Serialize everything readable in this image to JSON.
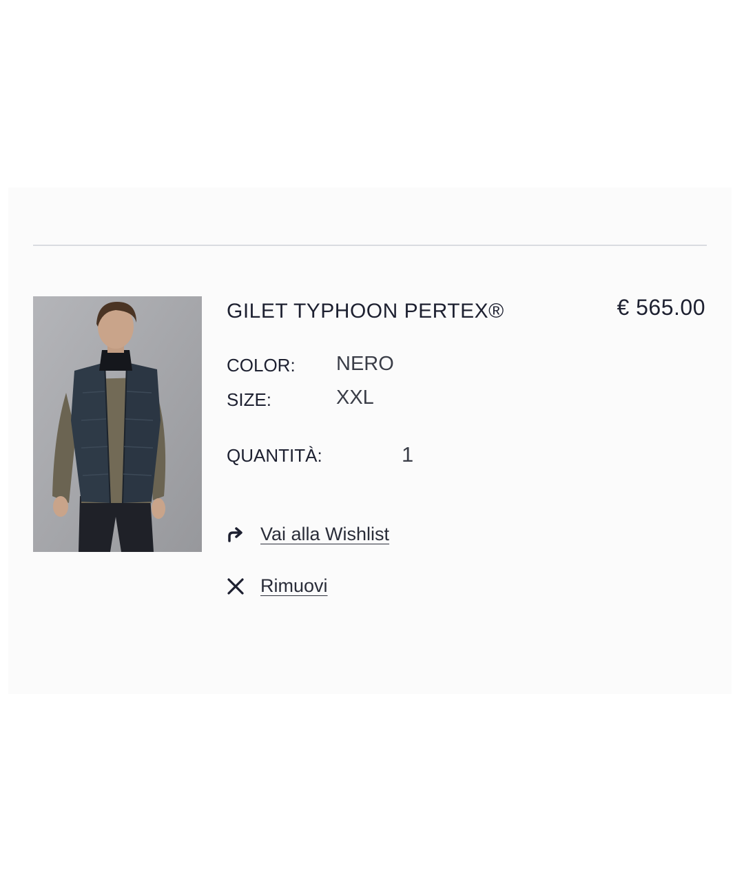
{
  "cart_item": {
    "name": "GILET TYPHOON PERTEX®",
    "price": "€ 565.00",
    "image_alt": "product-photo-model-wearing-navy-gilet",
    "attributes": {
      "color_label": "COLOR:",
      "color_value": "NERO",
      "size_label": "SIZE:",
      "size_value": "XXL",
      "quantity_label": "QUANTITÀ:",
      "quantity_value": "1"
    },
    "actions": {
      "wishlist_label": "Vai alla Wishlist",
      "wishlist_icon": "share-arrow-icon",
      "remove_label": "Rimuovi",
      "remove_icon": "close-icon"
    }
  },
  "colors": {
    "text": "#1d2030",
    "divider": "#d9dbe0",
    "background": "#fbfbfb"
  }
}
